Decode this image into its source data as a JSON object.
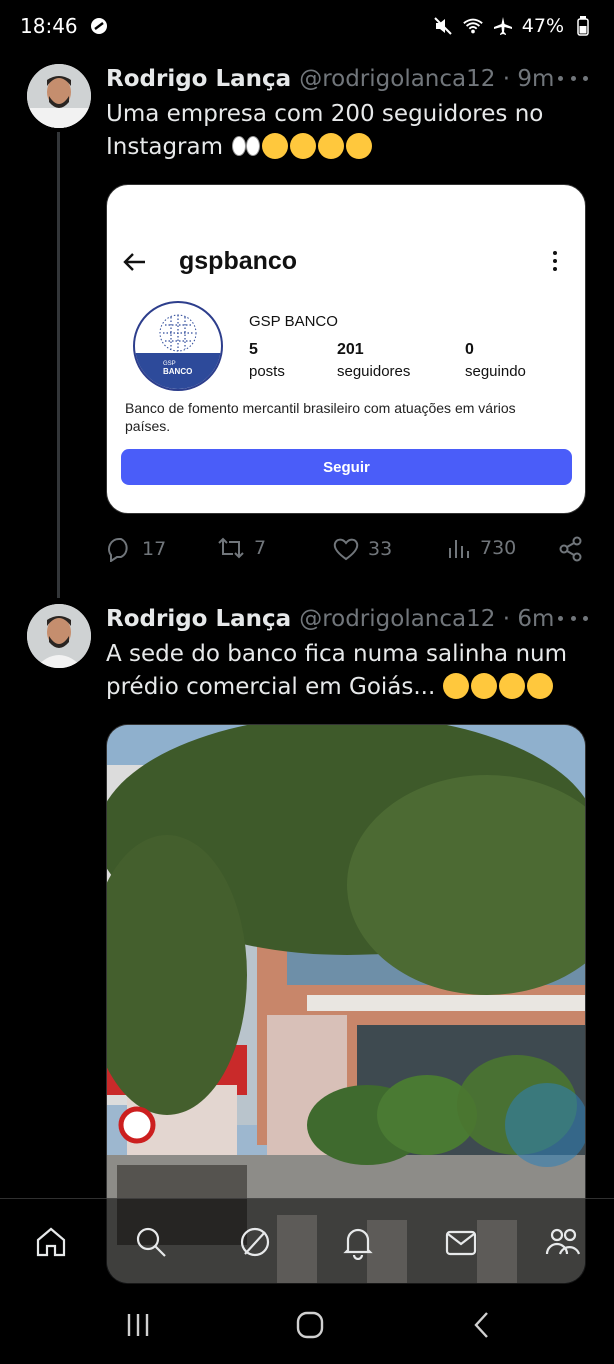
{
  "status_bar": {
    "time": "18:46",
    "battery": "47%"
  },
  "tweets": [
    {
      "name": "Rodrigo Lança",
      "handle": "@rodrigolanca12 · 9m",
      "text": "Uma empresa com 200 seguidores no Instagram",
      "emojis": [
        "eyes",
        "thinking-face",
        "thinking-face",
        "face-with-hand-over-mouth",
        "face-with-hand-over-mouth"
      ],
      "actions": {
        "replies": "17",
        "retweets": "7",
        "likes": "33",
        "views": "730"
      }
    },
    {
      "name": "Rodrigo Lança",
      "handle": "@rodrigolanca12 · 6m",
      "text": "A sede do banco fica numa salinha num prédio comercial em Goiás...",
      "emojis": [
        "thinking-face",
        "face-with-hand-over-mouth",
        "thinking-face",
        "face-with-hand-over-mouth"
      ]
    }
  ],
  "instagram_card": {
    "username": "gspbanco",
    "display_name": "GSP BANCO",
    "logo_text": "GSP\nBANCO",
    "logo_line1": "GSP",
    "logo_line2": "BANCO",
    "posts_count": "5",
    "posts_label": "posts",
    "followers_count": "201",
    "followers_label": "seguidores",
    "following_count": "0",
    "following_label": "seguindo",
    "bio": "Banco de fomento mercantil brasileiro com atuações em vários países.",
    "follow_button": "Seguir"
  },
  "colors": {
    "background": "#000000",
    "text": "#e7e9ea",
    "muted": "#71767b",
    "follow_button": "#4a5df9",
    "thread_line": "#333639"
  },
  "bottom_nav": [
    "home-icon",
    "search-icon",
    "grok-icon",
    "notifications-icon",
    "messages-icon",
    "communities-icon"
  ],
  "system_nav": [
    "recent-apps-icon",
    "home-button-icon",
    "back-icon"
  ]
}
